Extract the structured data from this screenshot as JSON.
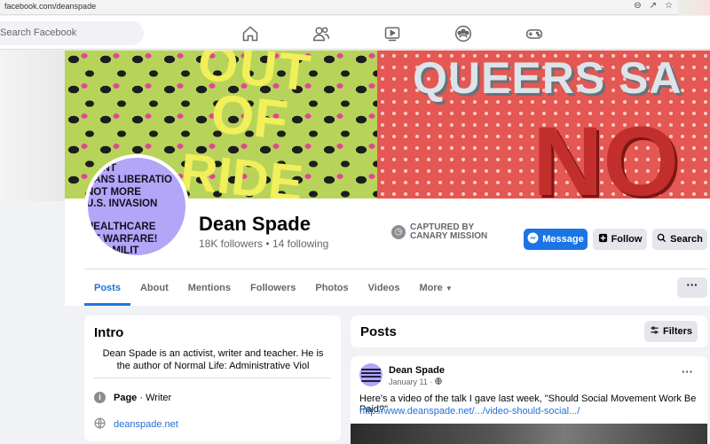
{
  "browser": {
    "url": "facebook.com/deanspade"
  },
  "topnav": {
    "search_placeholder": "Search Facebook",
    "icons": [
      "home-icon",
      "friends-icon",
      "watch-icon",
      "groups-icon",
      "gaming-icon"
    ]
  },
  "cover": {
    "left_lines": [
      "OUT",
      "OF",
      "RIDE"
    ],
    "right_lines": [
      "QUEERS SA",
      "NO"
    ]
  },
  "avatar": {
    "text": "WANT\nRANS LIBERATIO\nNOT MORE\nU.S. INVASION\n\nHEALTHCARE\nOT WARFARE!\n THE MILIT"
  },
  "profile": {
    "name": "Dean Spade",
    "followers": "18K followers",
    "separator": "•",
    "following": "14 following",
    "captured_line1": "CAPTURED BY",
    "captured_line2": "CANARY MISSION"
  },
  "actions": {
    "message": "Message",
    "follow": "Follow",
    "search": "Search",
    "more": "···"
  },
  "tabs": [
    {
      "label": "Posts",
      "active": true
    },
    {
      "label": "About"
    },
    {
      "label": "Mentions"
    },
    {
      "label": "Followers"
    },
    {
      "label": "Photos"
    },
    {
      "label": "Videos"
    },
    {
      "label": "More"
    }
  ],
  "intro": {
    "title": "Intro",
    "bio": "Dean Spade is an activist, writer and teacher. He is the author of Normal Life: Administrative Viol",
    "page_label": "Page",
    "page_category": " · Writer",
    "website": "deanspade.net"
  },
  "posts": {
    "title": "Posts",
    "filters": "Filters",
    "item": {
      "author": "Dean Spade",
      "date": "January 11 ·",
      "text": "Here's a video of the talk I gave last week, \"Should Social Movement Work Be Paid?\"",
      "link": "http://www.deanspade.net/.../video-should-social.../",
      "more": "···"
    }
  },
  "colors": {
    "accent": "#1b74e4",
    "link": "#216fdb",
    "avatar_bg": "#b3a5f7"
  }
}
